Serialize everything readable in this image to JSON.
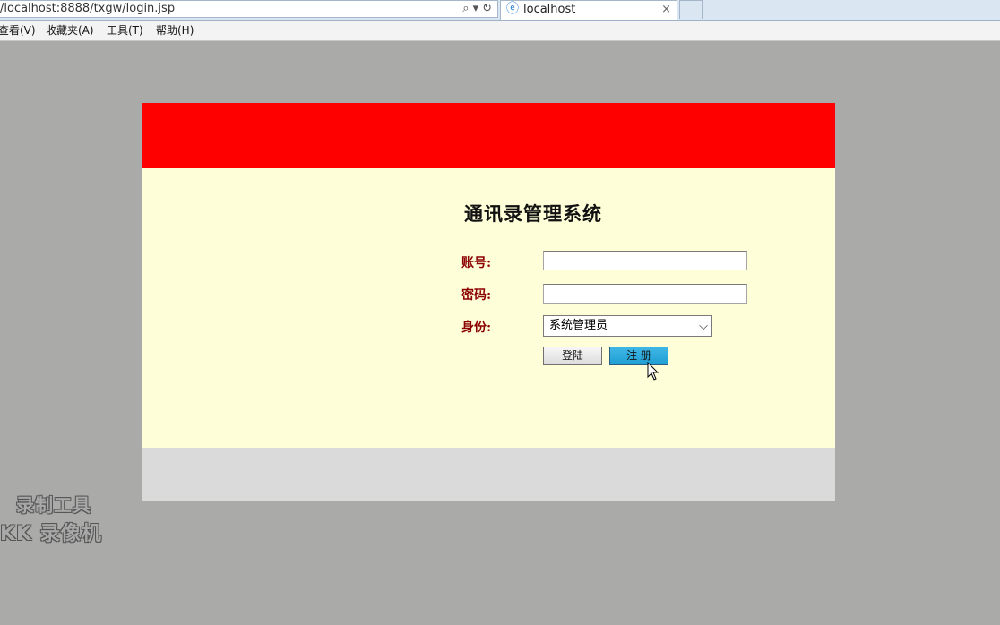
{
  "browser": {
    "url": "/localhost:8888/txgw/login.jsp",
    "tab_title": "localhost",
    "tab_close": "×",
    "menu": [
      "查看(V)",
      "收藏夹(A)",
      "工具(T)",
      "帮助(H)"
    ]
  },
  "login": {
    "system_title": "通讯录管理系统",
    "account_label": "账号:",
    "password_label": "密码:",
    "role_label": "身份:",
    "account_value": "",
    "password_value": "",
    "role_selected": "系统管理员",
    "login_button": "登陆",
    "register_button": "注 册"
  },
  "watermark": {
    "line1": "录制工具",
    "line2": "KK 录像机"
  },
  "colors": {
    "header_red": "#fe0000",
    "panel_bg": "#fefed8",
    "label_darkred": "#8b0000",
    "register_blue": "#2aa8dc"
  }
}
